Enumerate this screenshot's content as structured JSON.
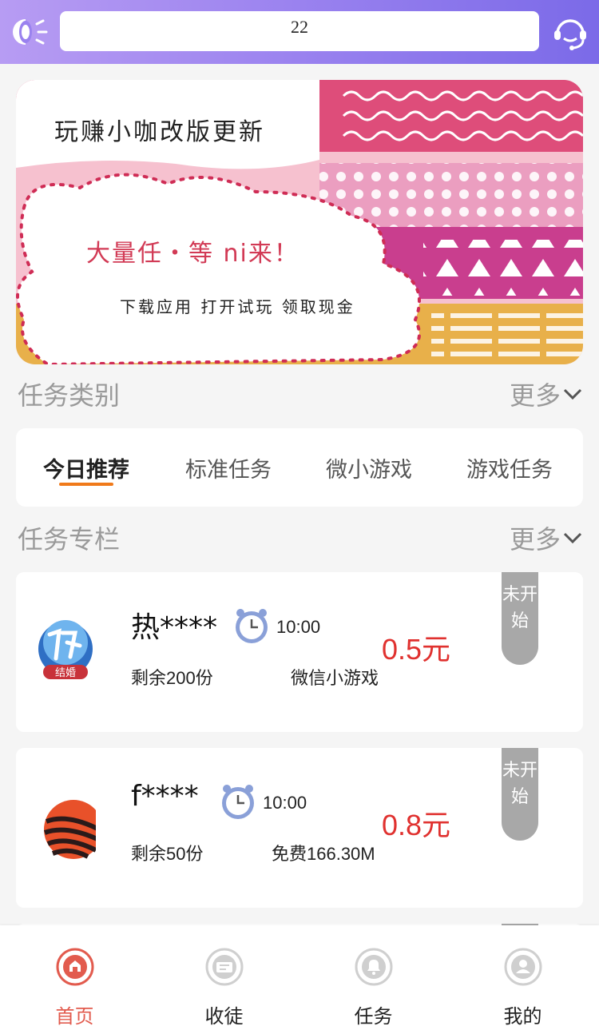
{
  "header": {
    "left_icon": "megaphone-icon",
    "search_value": "22",
    "right_icon": "customer-service-icon"
  },
  "banner": {
    "title": "玩赚小咖改版更新",
    "line2": "大量任・等 ni来！",
    "line3": "下载应用 打开试玩 领取现金"
  },
  "sections": {
    "categories": {
      "title": "任务类别",
      "more": "更多"
    },
    "column": {
      "title": "任务专栏",
      "more": "更多"
    }
  },
  "tabs": [
    {
      "label": "今日推荐",
      "active": true
    },
    {
      "label": "标准任务",
      "active": false
    },
    {
      "label": "微小游戏",
      "active": false
    },
    {
      "label": "游戏任务",
      "active": false
    }
  ],
  "tasks": [
    {
      "name": "热****",
      "time": "10:00",
      "remaining": "剩余200份",
      "info": "微信小游戏",
      "price": "0.5元",
      "status": "未开始",
      "logo_text": "结婚"
    },
    {
      "name": "f****",
      "time": "10:00",
      "remaining": "剩余50份",
      "info": "免费166.30M",
      "price": "0.8元",
      "status": "未开始"
    }
  ],
  "nav": [
    {
      "label": "首页",
      "icon": "home-icon",
      "active": true
    },
    {
      "label": "收徒",
      "icon": "apprentice-icon",
      "active": false
    },
    {
      "label": "任务",
      "icon": "bell-icon",
      "active": false
    },
    {
      "label": "我的",
      "icon": "profile-icon",
      "active": false
    }
  ],
  "colors": {
    "header_gradient_start": "#b79cf3",
    "header_gradient_end": "#7b6ae8",
    "price": "#e0312f",
    "active_nav": "#e25b4e",
    "tab_underline": "#f07a1a"
  }
}
